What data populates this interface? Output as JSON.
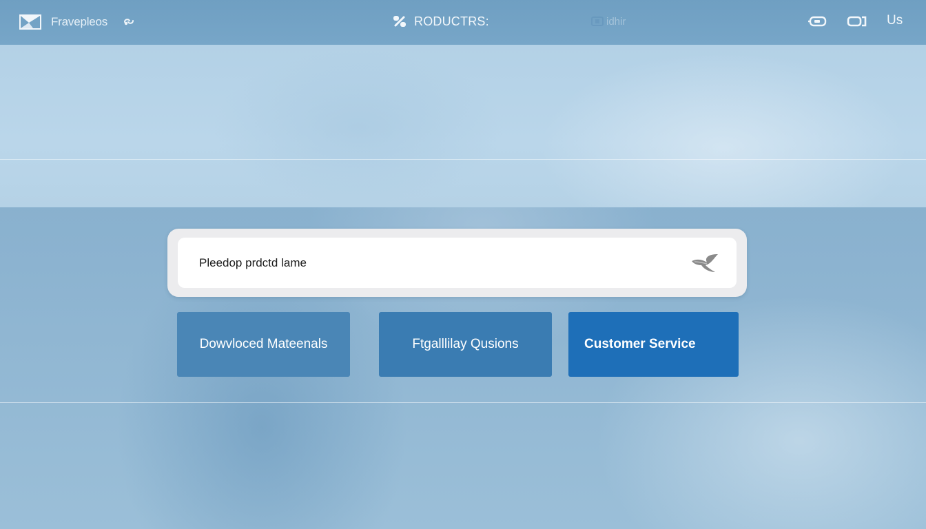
{
  "header": {
    "brand_name": "Fravepleos",
    "products_label": "RODUCTRS:",
    "faded_label": "idhir",
    "contact_label": "Us",
    "icons": [
      "brand-logo-icon",
      "link-icon",
      "products-icon",
      "faded-nav-icon",
      "cart-icon",
      "account-icon"
    ]
  },
  "search": {
    "placeholder": "Pleedop prdctd lame",
    "value": "",
    "button_icon": "search-arrow-icon"
  },
  "actions": {
    "downloads_label": "Dowvloced Mateenals",
    "faq_label": "Ftgalllilay  Qusions",
    "support_label": "Customer Service"
  },
  "colors": {
    "header_bg": "#77a6c8",
    "hero_bg": "#b5d2e6",
    "page_bg": "#8fb6d2",
    "card_downloads": "#4a86b6",
    "card_faq": "#3a7cb2",
    "card_support": "#1e6fb8"
  }
}
